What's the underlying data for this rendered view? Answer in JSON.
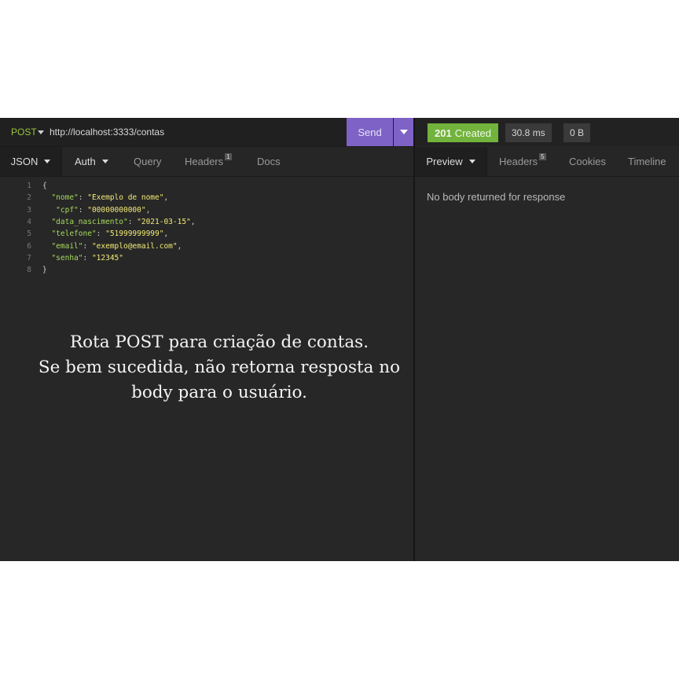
{
  "request": {
    "method": "POST",
    "url": "http://localhost:3333/contas",
    "send_label": "Send",
    "tabs": {
      "body": "JSON",
      "auth": "Auth",
      "query": "Query",
      "headers": "Headers",
      "headers_count": "1",
      "docs": "Docs"
    },
    "body_lines": [
      {
        "n": "1",
        "parts": [
          {
            "t": "{",
            "c": "p"
          }
        ]
      },
      {
        "n": "2",
        "parts": [
          {
            "t": "  ",
            "c": "p"
          },
          {
            "t": "\"nome\"",
            "c": "key"
          },
          {
            "t": ": ",
            "c": "p"
          },
          {
            "t": "\"Exemplo de nome\"",
            "c": "str"
          },
          {
            "t": ",",
            "c": "p"
          }
        ]
      },
      {
        "n": "3",
        "parts": [
          {
            "t": "   ",
            "c": "p"
          },
          {
            "t": "\"cpf\"",
            "c": "key"
          },
          {
            "t": ": ",
            "c": "p"
          },
          {
            "t": "\"00000000000\"",
            "c": "str"
          },
          {
            "t": ",",
            "c": "p"
          }
        ]
      },
      {
        "n": "4",
        "parts": [
          {
            "t": "  ",
            "c": "p"
          },
          {
            "t": "\"data_nascimento\"",
            "c": "key"
          },
          {
            "t": ": ",
            "c": "p"
          },
          {
            "t": "\"2021-03-15\"",
            "c": "str"
          },
          {
            "t": ",",
            "c": "p"
          }
        ]
      },
      {
        "n": "5",
        "parts": [
          {
            "t": "  ",
            "c": "p"
          },
          {
            "t": "\"telefone\"",
            "c": "key"
          },
          {
            "t": ": ",
            "c": "p"
          },
          {
            "t": "\"51999999999\"",
            "c": "str"
          },
          {
            "t": ",",
            "c": "p"
          }
        ]
      },
      {
        "n": "6",
        "parts": [
          {
            "t": "  ",
            "c": "p"
          },
          {
            "t": "\"email\"",
            "c": "key"
          },
          {
            "t": ": ",
            "c": "p"
          },
          {
            "t": "\"exemplo@email.com\"",
            "c": "str"
          },
          {
            "t": ",",
            "c": "p"
          }
        ]
      },
      {
        "n": "7",
        "parts": [
          {
            "t": "  ",
            "c": "p"
          },
          {
            "t": "\"senha\"",
            "c": "key"
          },
          {
            "t": ": ",
            "c": "p"
          },
          {
            "t": "\"12345\"",
            "c": "str"
          }
        ]
      },
      {
        "n": "8",
        "parts": [
          {
            "t": "}",
            "c": "p"
          }
        ]
      }
    ]
  },
  "response": {
    "status_code": "201",
    "status_text": "Created",
    "time": "30.8 ms",
    "size": "0 B",
    "tabs": {
      "preview": "Preview",
      "headers": "Headers",
      "headers_count": "5",
      "cookies": "Cookies",
      "timeline": "Timeline"
    },
    "message": "No body returned for response"
  },
  "caption": {
    "line1": "Rota POST para criação de contas.",
    "line2": "Se bem sucedida, não retorna resposta no",
    "line3": "body para o usuário."
  },
  "colors": {
    "method": "#9bc53d",
    "send": "#7e62c6",
    "status_ok": "#71b33c",
    "json_key": "#a6d95e",
    "json_string": "#f3ea76"
  }
}
